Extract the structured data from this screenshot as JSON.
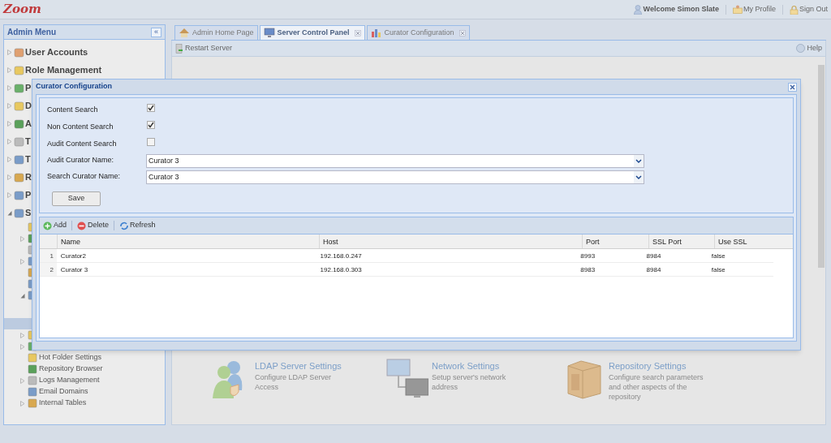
{
  "header": {
    "logo": "Zoom",
    "welcome": "Welcome Simon Slate",
    "links": [
      "My Profile",
      "Sign Out"
    ]
  },
  "sidebar": {
    "title": "Admin Menu",
    "collapse": "«",
    "items": [
      {
        "label": "User Accounts",
        "expanded": false
      },
      {
        "label": "Role Management",
        "expanded": false
      },
      {
        "label": "P",
        "expanded": false
      },
      {
        "label": "D",
        "expanded": false
      },
      {
        "label": "A",
        "expanded": false
      },
      {
        "label": "T",
        "expanded": false
      },
      {
        "label": "T",
        "expanded": false
      },
      {
        "label": "R",
        "expanded": false
      },
      {
        "label": "P",
        "expanded": false
      },
      {
        "label": "S",
        "expanded": true,
        "children": [
          {
            "selected": false
          },
          {
            "expanded": false,
            "selected": false
          },
          {
            "selected": false
          },
          {
            "expanded": false,
            "selected": false
          },
          {
            "selected": false
          },
          {
            "selected": false
          },
          {
            "expanded": true,
            "selected": false
          },
          {
            "selected": true
          },
          {
            "expanded": false,
            "selected": false
          },
          {
            "expanded": false,
            "selected": false
          },
          {
            "label": "Hot Folder Settings",
            "selected": false
          },
          {
            "label": "Repository Browser",
            "selected": false
          },
          {
            "label": "Logs Management",
            "expanded": false,
            "selected": false
          },
          {
            "label": "Email Domains",
            "selected": false
          },
          {
            "label": "Internal Tables",
            "expanded": false,
            "selected": false
          }
        ]
      }
    ]
  },
  "tabs": [
    {
      "label": "Admin Home Page",
      "selected": false,
      "closable": false
    },
    {
      "label": "Server Control Panel",
      "selected": true,
      "closable": true
    },
    {
      "label": "Curator Configuration",
      "selected": false,
      "closable": true
    }
  ],
  "toolbar": {
    "restart": "Restart Server",
    "help": "Help"
  },
  "settings_links": [
    {
      "title": "LDAP Server Settings",
      "description": "Configure LDAP Server Access"
    },
    {
      "title": "Network Settings",
      "description": "Setup server's network address"
    },
    {
      "title": "Repository Settings",
      "description": "Configure search parameters and other aspects of the repository"
    }
  ],
  "dialog": {
    "title": "Curator Configuration",
    "checkboxes": [
      {
        "label": "Content Search",
        "checked": true
      },
      {
        "label": "Non Content Search",
        "checked": true
      },
      {
        "label": "Audit Content Search",
        "checked": false
      }
    ],
    "combos": [
      {
        "label": "Audit Curator Name:",
        "value": "Curator 3"
      },
      {
        "label": "Search Curator Name:",
        "value": "Curator 3"
      }
    ],
    "save": "Save",
    "grid_toolbar": [
      "Add",
      "Delete",
      "Refresh"
    ],
    "table": {
      "columns": [
        "Name",
        "Host",
        "Port",
        "SSL Port",
        "Use SSL"
      ],
      "rows": [
        {
          "number": "1",
          "cells": [
            "Curator2",
            "192.168.0.247",
            "8993",
            "8984",
            "false"
          ]
        },
        {
          "number": "2",
          "cells": [
            "Curator 3",
            "192.168.0.303",
            "8983",
            "8984",
            "false"
          ]
        }
      ]
    }
  }
}
